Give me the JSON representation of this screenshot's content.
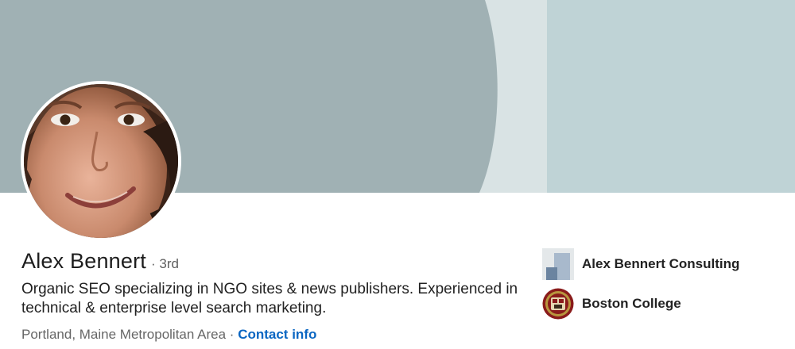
{
  "profile": {
    "name": "Alex Bennert",
    "degree": "3rd",
    "separator": "·",
    "headline": "Organic SEO specializing in NGO sites & news publishers. Experienced in technical & enterprise level search marketing.",
    "location": "Portland, Maine Metropolitan Area",
    "contact_label": "Contact info"
  },
  "sidebar": {
    "items": [
      {
        "label": "Alex Bennert Consulting",
        "icon": "company-logo-icon"
      },
      {
        "label": "Boston College",
        "icon": "boston-college-seal-icon"
      }
    ]
  },
  "colors": {
    "banner_dark": "#a0b1b4",
    "banner_light": "#bfd3d6",
    "banner_pale": "#d9e3e4",
    "link": "#0a66c2"
  }
}
